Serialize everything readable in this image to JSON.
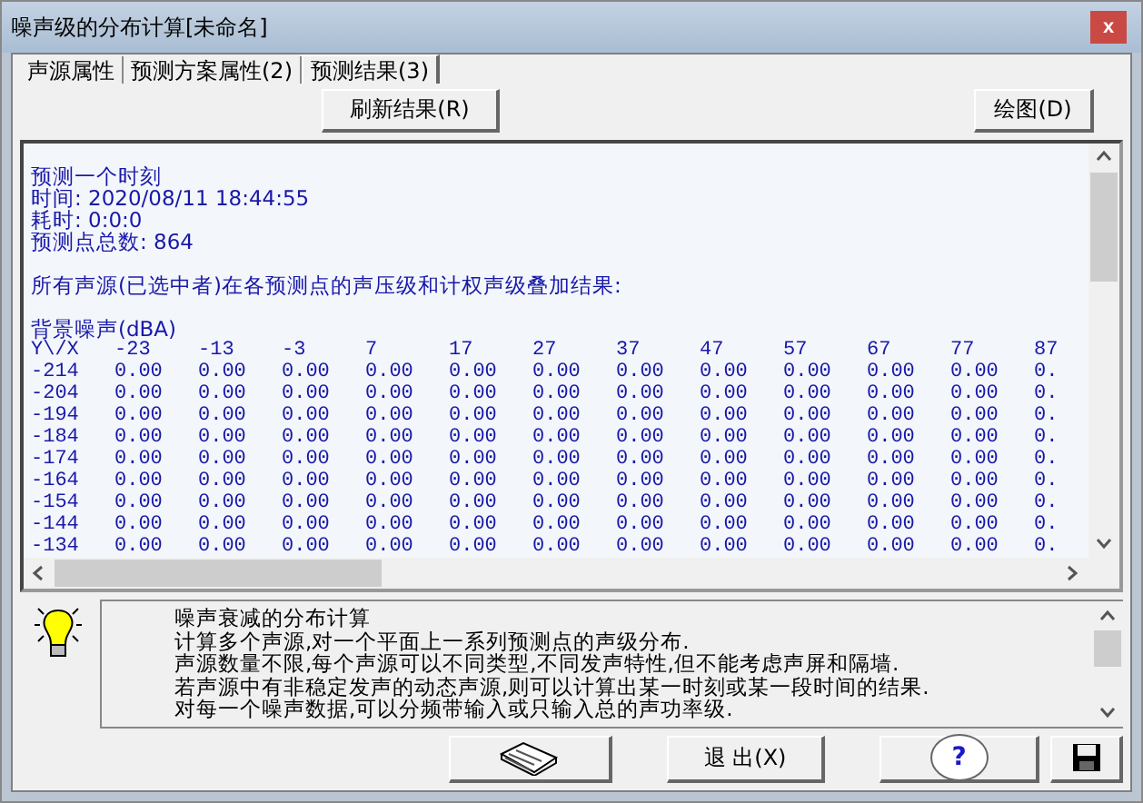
{
  "window": {
    "title": "噪声级的分布计算[未命名]",
    "close": "x"
  },
  "tabs": [
    {
      "label": "声源属性",
      "selected": false
    },
    {
      "label": "预测方案属性(2)",
      "selected": false
    },
    {
      "label": "预测结果(3)",
      "selected": true
    }
  ],
  "toolbar": {
    "refresh": "刷新结果(R)",
    "plot": "绘图(D)"
  },
  "results": {
    "lines": [
      "预测一个时刻",
      "时间: 2020/08/11 18:44:55",
      "耗时: 0:0:0",
      "预测点总数: 864"
    ],
    "summary": "所有声源(已选中者)在各预测点的声压级和计权声级叠加结果:",
    "table_title": "背景噪声(dBA)",
    "header": [
      "Y\\/X",
      "-23",
      "-13",
      "-3",
      "7",
      "17",
      "27",
      "37",
      "47",
      "57",
      "67",
      "77",
      "87"
    ],
    "rows": [
      [
        "-214",
        "0.00",
        "0.00",
        "0.00",
        "0.00",
        "0.00",
        "0.00",
        "0.00",
        "0.00",
        "0.00",
        "0.00",
        "0.00",
        "0."
      ],
      [
        "-204",
        "0.00",
        "0.00",
        "0.00",
        "0.00",
        "0.00",
        "0.00",
        "0.00",
        "0.00",
        "0.00",
        "0.00",
        "0.00",
        "0."
      ],
      [
        "-194",
        "0.00",
        "0.00",
        "0.00",
        "0.00",
        "0.00",
        "0.00",
        "0.00",
        "0.00",
        "0.00",
        "0.00",
        "0.00",
        "0."
      ],
      [
        "-184",
        "0.00",
        "0.00",
        "0.00",
        "0.00",
        "0.00",
        "0.00",
        "0.00",
        "0.00",
        "0.00",
        "0.00",
        "0.00",
        "0."
      ],
      [
        "-174",
        "0.00",
        "0.00",
        "0.00",
        "0.00",
        "0.00",
        "0.00",
        "0.00",
        "0.00",
        "0.00",
        "0.00",
        "0.00",
        "0."
      ],
      [
        "-164",
        "0.00",
        "0.00",
        "0.00",
        "0.00",
        "0.00",
        "0.00",
        "0.00",
        "0.00",
        "0.00",
        "0.00",
        "0.00",
        "0."
      ],
      [
        "-154",
        "0.00",
        "0.00",
        "0.00",
        "0.00",
        "0.00",
        "0.00",
        "0.00",
        "0.00",
        "0.00",
        "0.00",
        "0.00",
        "0."
      ],
      [
        "-144",
        "0.00",
        "0.00",
        "0.00",
        "0.00",
        "0.00",
        "0.00",
        "0.00",
        "0.00",
        "0.00",
        "0.00",
        "0.00",
        "0."
      ],
      [
        "-134",
        "0.00",
        "0.00",
        "0.00",
        "0.00",
        "0.00",
        "0.00",
        "0.00",
        "0.00",
        "0.00",
        "0.00",
        "0.00",
        "0."
      ]
    ]
  },
  "info": {
    "lines": [
      "噪声衰减的分布计算",
      "计算多个声源,对一个平面上一系列预测点的声级分布.",
      "声源数量不限,每个声源可以不同类型,不同发声特性,但不能考虑声屏和隔墙.",
      "若声源中有非稳定发声的动态声源,则可以计算出某一时刻或某一段时间的结果.",
      "对每一个噪声数据,可以分频带输入或只输入总的声功率级."
    ]
  },
  "buttons": [
    {
      "kind": "book"
    },
    {
      "kind": "text",
      "label": "退 出(X)"
    },
    {
      "kind": "help",
      "label": "?"
    },
    {
      "kind": "save"
    }
  ]
}
